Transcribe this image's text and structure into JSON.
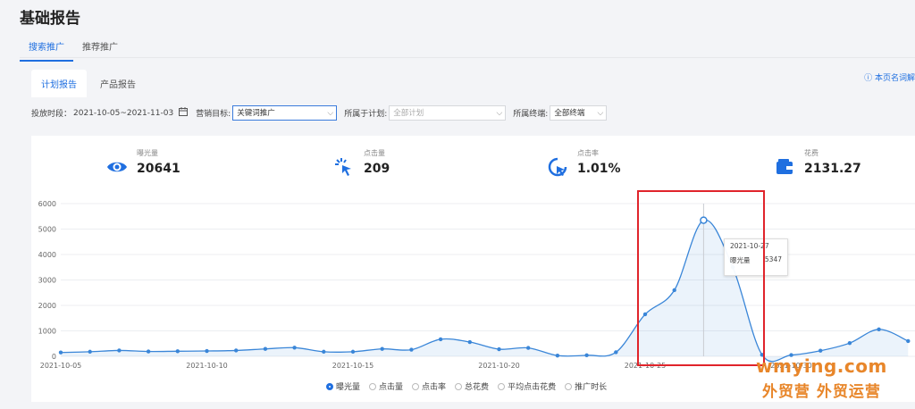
{
  "page_title": "基础报告",
  "top_tabs": [
    {
      "label": "搜索推广",
      "active": true
    },
    {
      "label": "推荐推广",
      "active": false
    }
  ],
  "sub_tabs": [
    {
      "label": "计划报告",
      "active": true
    },
    {
      "label": "产品报告",
      "active": false
    }
  ],
  "help_link": "本页名词解",
  "filters": {
    "period_label": "投放时段：",
    "period_value": "2021-10-05~2021-11-03",
    "goal_label": "营销目标:",
    "goal_value": "关键词推广",
    "plan_label": "所属于计划:",
    "plan_placeholder": "全部计划",
    "device_label": "所属终端:",
    "device_value": "全部终端"
  },
  "metrics": [
    {
      "label": "曝光量",
      "value": "20641",
      "icon": "eye-icon"
    },
    {
      "label": "点击量",
      "value": "209",
      "icon": "click-icon"
    },
    {
      "label": "点击率",
      "value": "1.01%",
      "icon": "cursor-click-icon"
    },
    {
      "label": "花费",
      "value": "2131.27",
      "icon": "wallet-icon"
    }
  ],
  "chart_data": {
    "type": "line",
    "x_tick_labels": [
      "2021-10-05",
      "2021-10-10",
      "2021-10-15",
      "2021-10-20",
      "2021-10-25",
      "2021-10-30"
    ],
    "ylim": [
      0,
      6000
    ],
    "yticks": [
      "0",
      "1000",
      "2000",
      "3000",
      "4000",
      "5000",
      "6000"
    ],
    "x": [
      "2021-10-05",
      "2021-10-06",
      "2021-10-07",
      "2021-10-08",
      "2021-10-09",
      "2021-10-10",
      "2021-10-11",
      "2021-10-12",
      "2021-10-13",
      "2021-10-14",
      "2021-10-15",
      "2021-10-16",
      "2021-10-17",
      "2021-10-18",
      "2021-10-19",
      "2021-10-20",
      "2021-10-21",
      "2021-10-22",
      "2021-10-23",
      "2021-10-24",
      "2021-10-25",
      "2021-10-26",
      "2021-10-27",
      "2021-10-28",
      "2021-10-29",
      "2021-10-30",
      "2021-10-31",
      "2021-11-01",
      "2021-11-02",
      "2021-11-03"
    ],
    "series": [
      {
        "name": "曝光量",
        "color": "#3a86d8",
        "values": [
          150,
          180,
          230,
          190,
          200,
          210,
          230,
          290,
          340,
          180,
          180,
          290,
          260,
          670,
          560,
          280,
          330,
          30,
          40,
          160,
          1650,
          2600,
          5347,
          3500,
          60,
          50,
          220,
          520,
          1060,
          600
        ]
      }
    ],
    "grid": true
  },
  "tooltip": {
    "date": "2021-10-27",
    "series": "曝光量",
    "value": "5347"
  },
  "legend": [
    {
      "label": "曝光量",
      "selected": true
    },
    {
      "label": "点击量",
      "selected": false
    },
    {
      "label": "点击率",
      "selected": false
    },
    {
      "label": "总花费",
      "selected": false
    },
    {
      "label": "平均点击花费",
      "selected": false
    },
    {
      "label": "推广时长",
      "selected": false
    }
  ],
  "watermark": {
    "line1": "wmying.com",
    "line2": "外贸营 外贸运营"
  }
}
